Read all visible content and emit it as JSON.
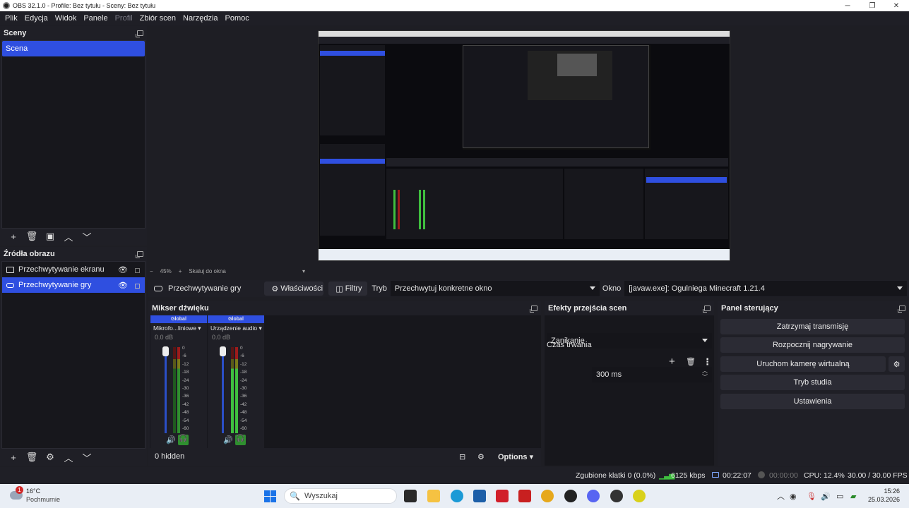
{
  "window": {
    "title": "OBS 32.1.0 - Profile: Bez tytułu - Sceny: Bez tytułu"
  },
  "menu": [
    "Plik",
    "Edycja",
    "Widok",
    "Panele",
    "Profil",
    "Zbiór scen",
    "Narzędzia",
    "Pomoc"
  ],
  "scenes": {
    "title": "Sceny",
    "items": [
      "Scena"
    ]
  },
  "sources": {
    "title": "Źródła obrazu",
    "items": [
      "Przechwytywanie ekranu",
      "Przechwytywanie gry"
    ]
  },
  "context": {
    "source_name": "Przechwytywanie gry",
    "properties_label": "Właściwości",
    "filters_label": "Filtry",
    "mode_label": "Tryb",
    "mode_value": "Przechwytuj konkretne okno",
    "window_label": "Okno",
    "window_value": "[javaw.exe]: Ogulniega Minecraft 1.21.4"
  },
  "preview": {
    "zoom": "45%",
    "zoom_option": "Skaluj do okna"
  },
  "mixer": {
    "title": "Mikser dźwięku",
    "channels": [
      {
        "badge": "Global",
        "name": "Mikrofo...liniowe",
        "db": "0.0 dB"
      },
      {
        "badge": "Global",
        "name": "Urządzenie audio",
        "db": "0.0 dB"
      }
    ],
    "scale": [
      "0",
      "-6",
      "-12",
      "-18",
      "-24",
      "-30",
      "-36",
      "-42",
      "-48",
      "-54",
      "-60"
    ],
    "hidden": "0 hidden",
    "options": "Options"
  },
  "transitions": {
    "title": "Efekty przejścia scen",
    "type": "Zanikanie",
    "duration_label": "Czas trwania",
    "duration_value": "300 ms"
  },
  "controls": {
    "title": "Panel sterujący",
    "stop_stream": "Zatrzymaj transmisję",
    "start_record": "Rozpocznij nagrywanie",
    "virtual_cam": "Uruchom kamerę wirtualną",
    "studio": "Tryb studia",
    "settings": "Ustawienia"
  },
  "status": {
    "dropped": "Zgubione klatki 0 (0.0%)",
    "bitrate": "6125 kbps",
    "stream_time": "00:22:07",
    "rec_time": "00:00:00",
    "cpu": "CPU: 12.4%",
    "fps": "30.00 / 30.00 FPS"
  },
  "taskbar": {
    "weather_temp": "16°C",
    "weather_desc": "Pochmurnie",
    "weather_badge": "1",
    "search": "Wyszukaj",
    "time": "15:26",
    "date": "25.03.2026"
  },
  "colors": {
    "accent": "#2f4fe0",
    "panel": "#1f1f26",
    "meter_green": "#3fbf3f",
    "meter_red": "#9e1b1b"
  }
}
